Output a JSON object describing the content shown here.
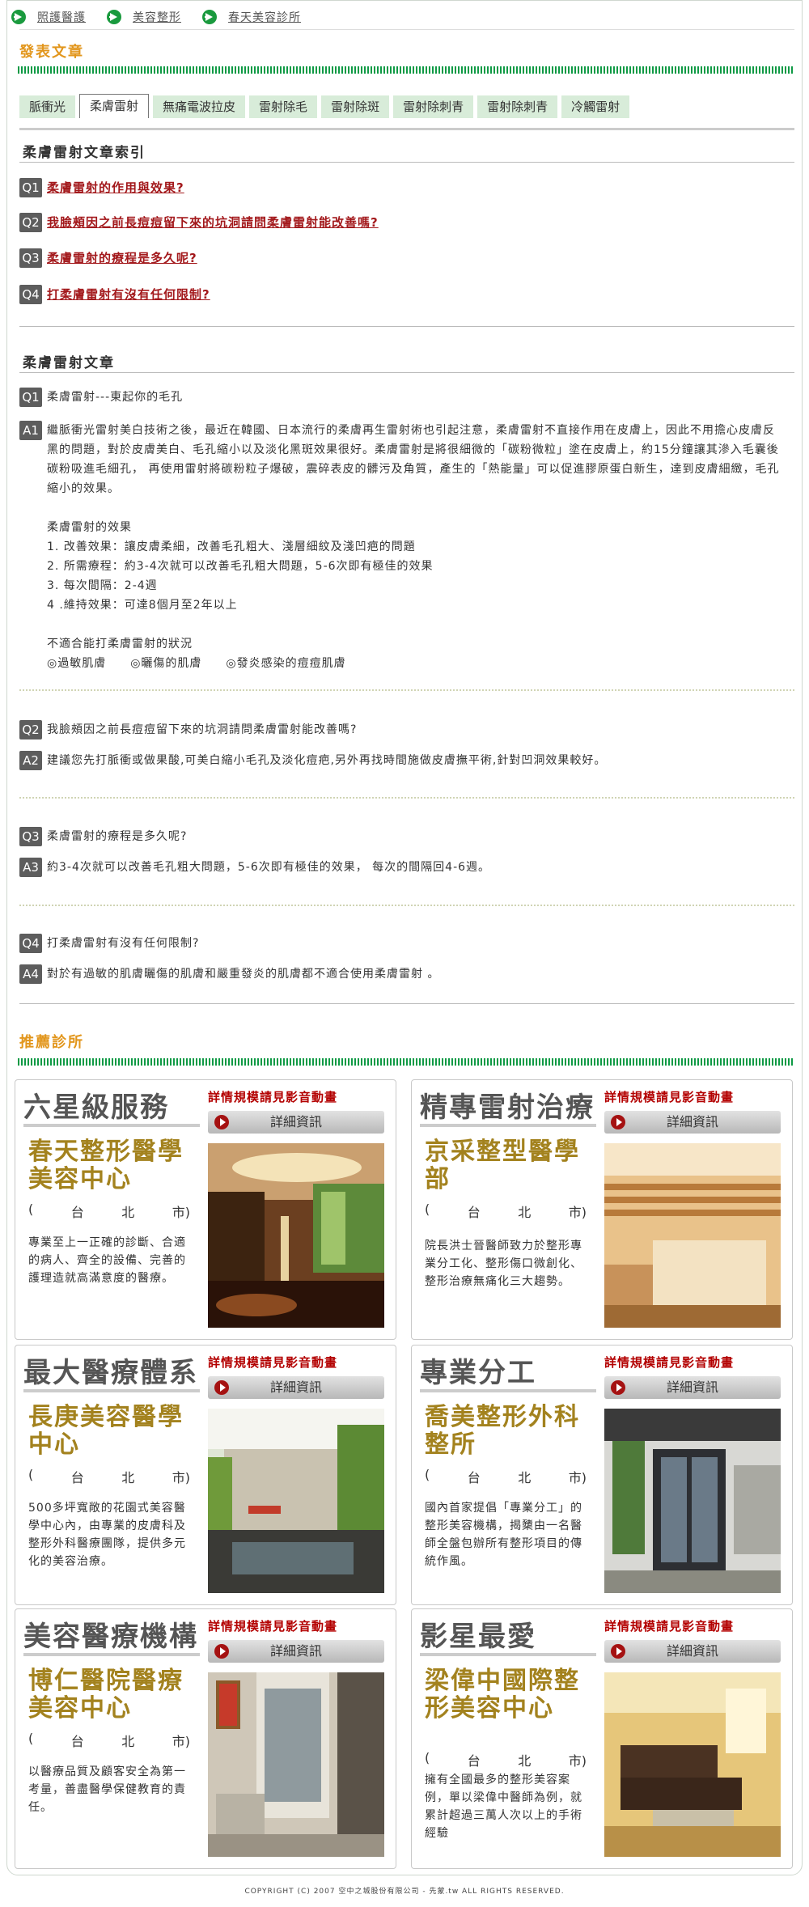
{
  "breadcrumb": [
    "照護醫護",
    "美容整形",
    "春天美容診所"
  ],
  "section_articles": "發表文章",
  "tabs": [
    {
      "label": "脈衝光"
    },
    {
      "label": "柔膚雷射"
    },
    {
      "label": "無痛電波拉皮"
    },
    {
      "label": "雷射除毛"
    },
    {
      "label": "雷射除斑"
    },
    {
      "label": "雷射除刺青"
    },
    {
      "label": "雷射除刺青"
    },
    {
      "label": "冷觸雷射"
    }
  ],
  "index_title": "柔膚雷射文章索引",
  "index": [
    {
      "badge": "Q1",
      "text": "柔膚雷射的作用與效果?"
    },
    {
      "badge": "Q2",
      "text": "我臉頰因之前長痘痘留下來的坑洞請問柔膚雷射能改善嗎?"
    },
    {
      "badge": "Q3",
      "text": "柔膚雷射的療程是多久呢?"
    },
    {
      "badge": "Q4",
      "text": "打柔膚雷射有沒有任何限制?"
    }
  ],
  "article_title": "柔膚雷射文章",
  "qa1": {
    "q_badge": "Q1",
    "q": "柔膚雷射---東起你的毛孔",
    "a_badge": "A1",
    "para": "繼脈衝光雷射美白技術之後，最近在韓國、日本流行的柔膚再生雷射術也引起注意，柔膚雷射不直接作用在皮膚上，因此不用擔心皮膚反黑的問題，對於皮膚美白、毛孔縮小以及淡化黑斑效果很好。柔膚雷射是將很細微的「碳粉微粒」塗在皮膚上，約15分鐘讓其滲入毛囊後碳粉吸進毛細孔，  再使用雷射將碳粉粒子爆破，震碎表皮的髒污及角質，產生的「熱能量」可以促進膠原蛋白新生，達到皮膚細緻，毛孔縮小的效果。",
    "effects_title": "柔膚雷射的效果",
    "effects": [
      "1. 改善效果：讓皮膚柔細，改善毛孔粗大、淺層細紋及淺凹疤的問題",
      "2. 所需療程：約3-4次就可以改善毛孔粗大問題，5-6次即有極佳的效果",
      "3. 每次間隔：2-4週",
      "4 .維持效果：可達8個月至2年以上"
    ],
    "unsuitable_title": "不適合能打柔膚雷射的狀況",
    "unsuitable": "◎過敏肌膚　　◎曬傷的肌膚　　◎發炎感染的痘痘肌膚"
  },
  "qa2": {
    "q_badge": "Q2",
    "q": "我臉頰因之前長痘痘留下來的坑洞請問柔膚雷射能改善嗎?",
    "a_badge": "A2",
    "a": "建議您先打脈衝或做果酸,可美白縮小毛孔及淡化痘疤,另外再找時間施做皮膚撫平術,針對凹洞效果較好。"
  },
  "qa3": {
    "q_badge": "Q3",
    "q": "柔膚雷射的療程是多久呢?",
    "a_badge": "A3",
    "a": "約3-4次就可以改善毛孔粗大問題，5-6次即有極佳的效果，  每次的間隔回4-6週。"
  },
  "qa4": {
    "q_badge": "Q4",
    "q": "打柔膚雷射有沒有任何限制?",
    "a_badge": "A4",
    "a": "對於有過敏的肌膚曬傷的肌膚和嚴重發炎的肌膚都不適合使用柔膚雷射  。"
  },
  "section_clinics": "推薦診所",
  "clinics": [
    {
      "slogan": "六星級服務",
      "promo": "詳情規模請見影音動畫",
      "button": "詳細資訊",
      "name": "春天整形醫學美容中心",
      "city": [
        "(",
        "台",
        "北",
        "市)"
      ],
      "desc": "專業至上一正確的診斷、合適的病人、齊全的設備、完善的護理造就高滿意度的醫療。",
      "photo": "lobby-photo"
    },
    {
      "slogan": "精專雷射治療",
      "promo": "詳情規模請見影音動畫",
      "button": "詳細資訊",
      "name": "京采整型醫學部",
      "city": [
        "(",
        "台",
        "北",
        "市)"
      ],
      "desc": "院長洪士晉醫師致力於整形專業分工化、整形傷口微創化、整形治療無痛化三大趨勢。",
      "photo": "reception-photo"
    },
    {
      "slogan": "最大醫療體系",
      "promo": "詳情規模請見影音動畫",
      "button": "詳細資訊",
      "name": "長庚美容醫學中心",
      "city": [
        "(",
        "台",
        "北",
        "市)"
      ],
      "desc": "500多坪寬敞的花園式美容醫學中心內，由專業的皮膚科及整形外科醫療團隊，提供多元化的美容治療。",
      "photo": "garden-photo"
    },
    {
      "slogan": "專業分工",
      "promo": "詳情規模請見影音動畫",
      "button": "詳細資訊",
      "name": "喬美整形外科整所",
      "city": [
        "(",
        "台",
        "北",
        "市)"
      ],
      "desc": "國內首家提倡「專業分工」的整形美容機構，揭櫫由一名醫師全盤包辦所有整形項目的傳統作風。",
      "photo": "entrance-photo"
    },
    {
      "slogan": "美容醫療機構",
      "promo": "詳情規模請見影音動畫",
      "button": "詳細資訊",
      "name": "博仁醫院醫療美容中心",
      "city": [
        "(",
        "台",
        "北",
        "市)"
      ],
      "desc": "以醫療品質及顧客安全為第一考量，善盡醫學保健教育的責任。",
      "photo": "hall-photo"
    },
    {
      "slogan": "影星最愛",
      "promo": "詳情規模請見影音動畫",
      "button": "詳細資訊",
      "name": "梁偉中國際整形美容中心",
      "city": [
        "(",
        "台",
        "北",
        "市)"
      ],
      "desc": "擁有全國最多的整形美容案例，單以梁偉中醫師為例，就累計超過三萬人次以上的手術經驗",
      "photo": "lounge-photo"
    }
  ],
  "copyright": "COPYRIGHT (C) 2007 空中之城股份有限公司 - 先蒙.tw ALL RIGHTS RESERVED."
}
